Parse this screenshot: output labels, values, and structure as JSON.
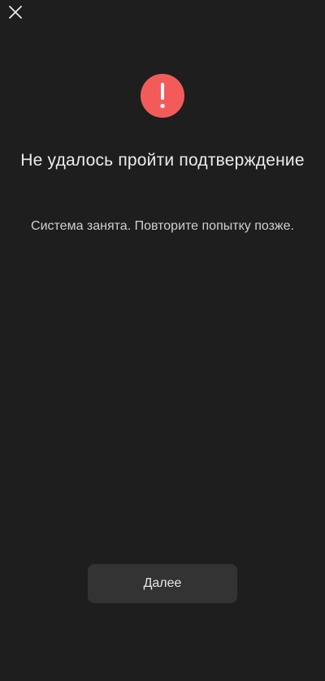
{
  "header": {
    "close_icon": "close-icon"
  },
  "status": {
    "icon": "exclamation-icon",
    "icon_color": "#f35b5b",
    "title": "Не удалось пройти подтверждение",
    "message": "Система занята. Повторите попытку позже."
  },
  "actions": {
    "next_label": "Далее"
  },
  "colors": {
    "background": "#1e1e1e",
    "button_background": "#333333",
    "text_primary": "#ececec",
    "text_secondary": "#cfcfcf"
  }
}
